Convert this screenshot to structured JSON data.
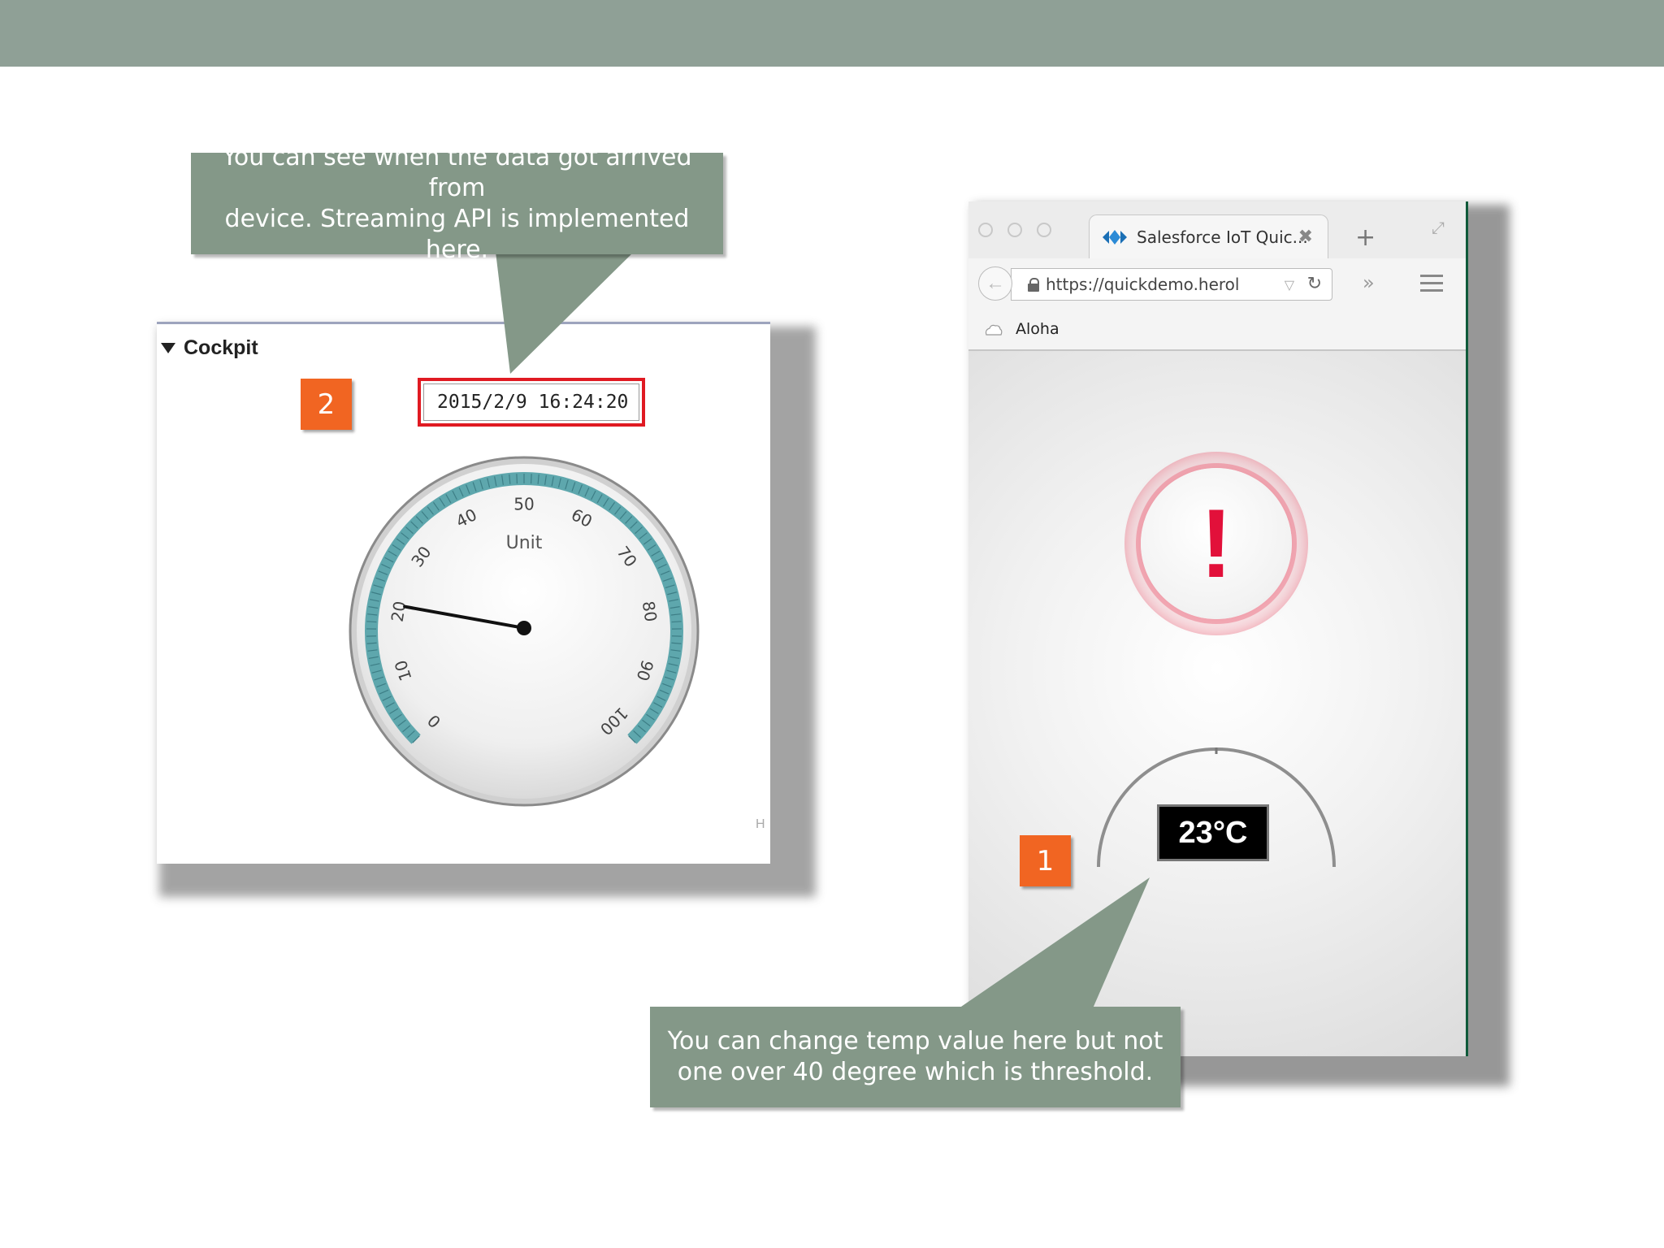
{
  "callouts": {
    "top_line1": "You can see when the data got arrived from",
    "top_line2": "device. Streaming API is implemented here.",
    "bottom_line1": "You can change temp value here but not",
    "bottom_line2": "one over 40 degree which is threshold."
  },
  "badges": {
    "two": "2",
    "one": "1"
  },
  "cockpit": {
    "header": "Cockpit",
    "timestamp": "2015/2/9 16:24:20",
    "gauge": {
      "unit_label": "Unit",
      "ticks": [
        "0",
        "10",
        "20",
        "30",
        "40",
        "50",
        "60",
        "70",
        "80",
        "90",
        "100"
      ],
      "min": 0,
      "max": 100,
      "value": 21
    },
    "hint": "H"
  },
  "browser": {
    "tab_title": "Salesforce IoT Quic...",
    "url": "https://quickdemo.herol",
    "bookmark": "Aloha",
    "alert_symbol": "!",
    "temperature": "23°C",
    "colors": {
      "alert": "#e2103a",
      "gauge_arc": "#5ea7ad",
      "badge": "#f16522",
      "callout": "#849888"
    }
  }
}
